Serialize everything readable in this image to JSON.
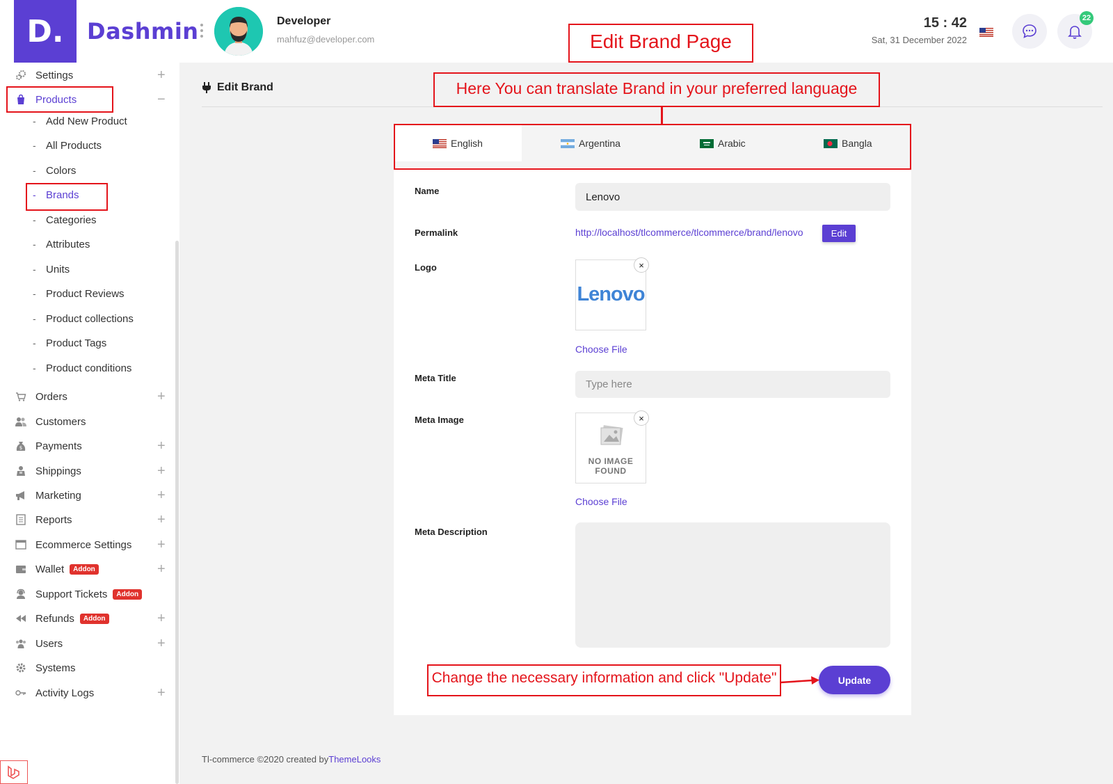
{
  "header": {
    "brand": "Dashmin",
    "logo_letter": "D.",
    "user_name": "Developer",
    "user_email": "mahfuz@developer.com",
    "time": "15 : 42",
    "date": "Sat, 31 December 2022",
    "notification_count": "22"
  },
  "sidebar": {
    "settings": "Settings",
    "products": "Products",
    "product_sub": [
      "Add New Product",
      "All Products",
      "Colors",
      "Brands",
      "Categories",
      "Attributes",
      "Units",
      "Product Reviews",
      "Product collections",
      "Product Tags",
      "Product conditions"
    ],
    "orders": "Orders",
    "customers": "Customers",
    "payments": "Payments",
    "shippings": "Shippings",
    "marketing": "Marketing",
    "reports": "Reports",
    "ecommerce_settings": "Ecommerce Settings",
    "wallet": "Wallet",
    "support_tickets": "Support Tickets",
    "refunds": "Refunds",
    "users": "Users",
    "systems": "Systems",
    "activity_logs": "Activity Logs",
    "addon_label": "Addon",
    "dash": "-"
  },
  "page": {
    "title": "Edit Brand",
    "tabs": [
      "English",
      "Argentina",
      "Arabic",
      "Bangla"
    ]
  },
  "form": {
    "name_label": "Name",
    "name_value": "Lenovo",
    "permalink_label": "Permalink",
    "permalink_url": "http://localhost/tlcommerce/tlcommerce/brand/lenovo",
    "edit_label": "Edit",
    "logo_label": "Logo",
    "logo_text": "Lenovo",
    "choose_file": "Choose File",
    "meta_title_label": "Meta Title",
    "meta_title_placeholder": "Type here",
    "meta_image_label": "Meta Image",
    "no_image_text_1": "NO IMAGE",
    "no_image_text_2": "FOUND",
    "meta_description_label": "Meta Description",
    "update_label": "Update",
    "remove_glyph": "×"
  },
  "annotations": {
    "title": "Edit Brand Page",
    "translate": "Here You can translate Brand in your preferred language",
    "update_hint": "Change the necessary information and click \"Update\""
  },
  "footer": {
    "text": "Tl-commerce ©2020 created by",
    "link": "ThemeLooks"
  },
  "colors": {
    "accent": "#5b3fd3",
    "annotation_red": "#e4141b",
    "badge_green": "#34c97a",
    "addon_red": "#e0322d"
  }
}
